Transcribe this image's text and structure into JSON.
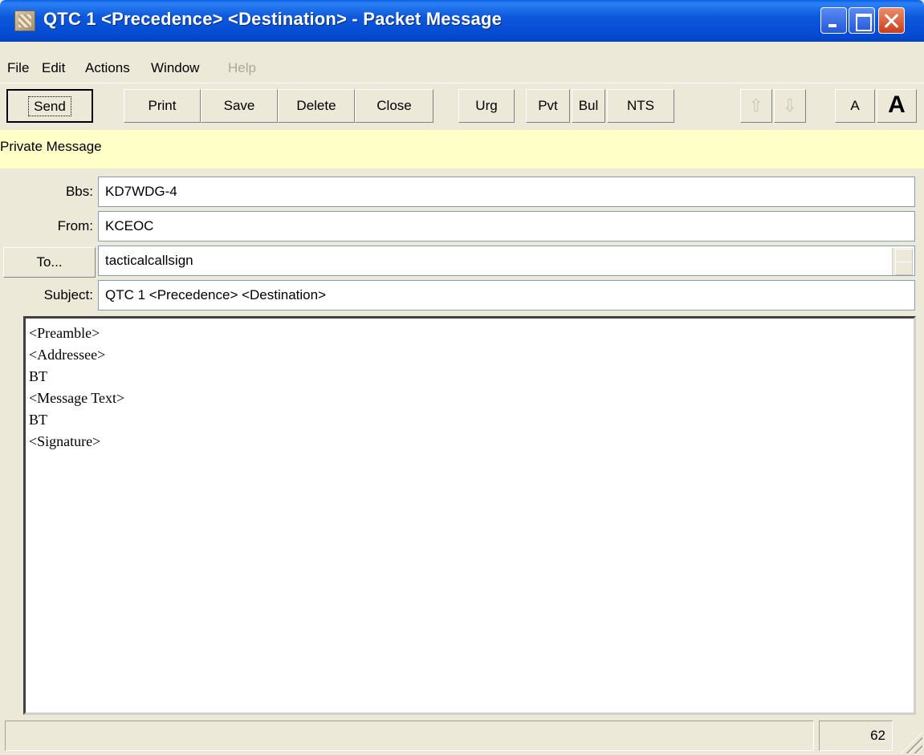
{
  "window": {
    "title": "QTC 1 <Precedence> <Destination> - Packet Message",
    "icon": "app-icon",
    "controls": [
      "minimize-icon",
      "maximize-icon",
      "close-icon"
    ]
  },
  "menu": {
    "file": "File",
    "edit": "Edit",
    "actions": "Actions",
    "window": "Window",
    "help": "Help"
  },
  "toolbar": {
    "send": "Send",
    "print": "Print",
    "save": "Save",
    "delete": "Delete",
    "close": "Close",
    "urg": "Urg",
    "pvt": "Pvt",
    "bul": "Bul",
    "nts": "NTS",
    "up_icon": "up-arrow-icon",
    "down_icon": "down-arrow-icon",
    "font_small": "A",
    "font_large": "A"
  },
  "message_type": "Private Message",
  "form": {
    "bbs_label": "Bbs:",
    "bbs_value": "KD7WDG-4",
    "from_label": "From:",
    "from_value": "KCEOC",
    "to_button": "To...",
    "to_value": "tacticalcallsign",
    "subject_label": "Subject:",
    "subject_value": "QTC 1 <Precedence> <Destination>"
  },
  "body": {
    "lines": [
      "<Preamble>",
      "<Addressee>",
      "BT",
      "<Message Text>",
      "BT",
      "<Signature>"
    ]
  },
  "status": {
    "char_count": "62"
  },
  "colors": {
    "titlebar": "#0549d0",
    "window_bg": "#ece9d8",
    "strip_bg": "#ffffc8"
  }
}
